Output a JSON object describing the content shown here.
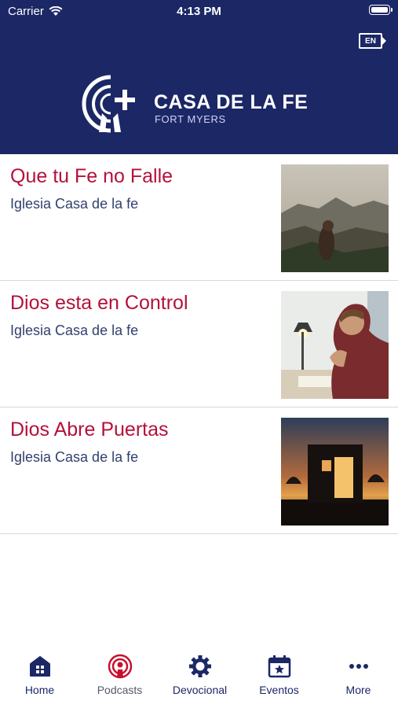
{
  "status_bar": {
    "carrier": "Carrier",
    "time": "4:13 PM"
  },
  "header": {
    "language_button": "EN",
    "brand_name": "CASA DE LA FE",
    "brand_location": "FORT MYERS"
  },
  "podcasts": [
    {
      "title": "Que tu Fe no Falle",
      "author": "Iglesia Casa de la fe"
    },
    {
      "title": "Dios esta en Control",
      "author": "Iglesia Casa de la fe"
    },
    {
      "title": "Dios Abre Puertas",
      "author": "Iglesia Casa de la fe"
    }
  ],
  "tabs": [
    {
      "label": "Home",
      "icon": "home-icon"
    },
    {
      "label": "Podcasts",
      "icon": "podcast-icon"
    },
    {
      "label": "Devocional",
      "icon": "gear-icon"
    },
    {
      "label": "Eventos",
      "icon": "calendar-star-icon"
    },
    {
      "label": "More",
      "icon": "more-dots-icon"
    }
  ],
  "colors": {
    "header_bg": "#1c2766",
    "title": "#b5103c",
    "tab_active": "#1c2766",
    "podcast_icon": "#c8102e"
  }
}
